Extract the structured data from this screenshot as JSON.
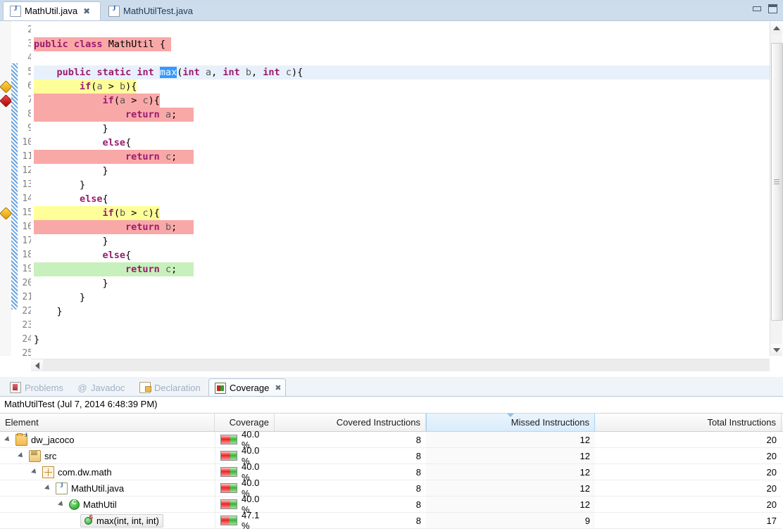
{
  "window": {
    "minimize_label": "Minimize",
    "restore_label": "Restore"
  },
  "editor": {
    "tabs": [
      {
        "label": "MathUtil.java",
        "icon": "java-file-icon",
        "active": true,
        "close": "✖"
      },
      {
        "label": "MathUtilTest.java",
        "icon": "java-file-icon",
        "active": false,
        "close": ""
      }
    ],
    "first_visible_line": 2,
    "last_visible_line": 25,
    "lines": [
      {
        "num": "2",
        "text": ""
      },
      {
        "num": "3",
        "text": "public class MathUtil {"
      },
      {
        "num": "4",
        "text": ""
      },
      {
        "num": "5",
        "text": "    public static int max(int a, int b, int c){"
      },
      {
        "num": "6",
        "text": "        if(a > b){"
      },
      {
        "num": "7",
        "text": "            if(a > c){"
      },
      {
        "num": "8",
        "text": "                return a;"
      },
      {
        "num": "9",
        "text": "            }"
      },
      {
        "num": "10",
        "text": "            else{"
      },
      {
        "num": "11",
        "text": "                return c;"
      },
      {
        "num": "12",
        "text": "            }"
      },
      {
        "num": "13",
        "text": "        }"
      },
      {
        "num": "14",
        "text": "        else{"
      },
      {
        "num": "15",
        "text": "            if(b > c){"
      },
      {
        "num": "16",
        "text": "                return b;"
      },
      {
        "num": "17",
        "text": "            }"
      },
      {
        "num": "18",
        "text": "            else{"
      },
      {
        "num": "19",
        "text": "                return c;"
      },
      {
        "num": "20",
        "text": "            }"
      },
      {
        "num": "21",
        "text": "        }"
      },
      {
        "num": "22",
        "text": "    }"
      },
      {
        "num": "23",
        "text": ""
      },
      {
        "num": "24",
        "text": "}"
      },
      {
        "num": "25",
        "text": ""
      }
    ],
    "selected_token": "max",
    "gutter_markers": [
      {
        "line": "6",
        "type": "partial-coverage-marker",
        "color": "#ffd84d"
      },
      {
        "line": "7",
        "type": "no-coverage-marker",
        "color": "#ef4a4a"
      },
      {
        "line": "15",
        "type": "partial-coverage-marker",
        "color": "#ffd84d"
      }
    ],
    "coverage_colors": {
      "covered": "#c8f0bc",
      "missed": "#f9a8a8",
      "partial": "#ffff9a",
      "current_line": "#e8f1fb",
      "selection": "#3399ff"
    }
  },
  "bottom_view": {
    "tabs": [
      {
        "label": "Problems",
        "icon": "problems-icon",
        "active": false,
        "close": ""
      },
      {
        "label": "Javadoc",
        "icon": "javadoc-icon",
        "active": false,
        "close": ""
      },
      {
        "label": "Declaration",
        "icon": "declaration-icon",
        "active": false,
        "close": ""
      },
      {
        "label": "Coverage",
        "icon": "coverage-icon",
        "active": true,
        "close": "✖"
      }
    ],
    "session": "MathUtilTest (Jul 7, 2014 6:48:39 PM)",
    "columns": [
      {
        "key": "element",
        "label": "Element"
      },
      {
        "key": "coverage",
        "label": "Coverage"
      },
      {
        "key": "covered",
        "label": "Covered Instructions"
      },
      {
        "key": "missed",
        "label": "Missed Instructions",
        "sorted": true,
        "sort_direction": "descending"
      },
      {
        "key": "total",
        "label": "Total Instructions"
      }
    ],
    "rows": [
      {
        "element": "dw_jacoco",
        "icon": "java-project-icon",
        "depth": 0,
        "expanded": true,
        "selected": false,
        "coverage": "40.0 %",
        "covered": "8",
        "missed": "12",
        "total": "20",
        "bar_percent": 40
      },
      {
        "element": "src",
        "icon": "source-folder-icon",
        "depth": 1,
        "expanded": true,
        "selected": false,
        "coverage": "40.0 %",
        "covered": "8",
        "missed": "12",
        "total": "20",
        "bar_percent": 40
      },
      {
        "element": "com.dw.math",
        "icon": "package-icon",
        "depth": 2,
        "expanded": true,
        "selected": false,
        "coverage": "40.0 %",
        "covered": "8",
        "missed": "12",
        "total": "20",
        "bar_percent": 40
      },
      {
        "element": "MathUtil.java",
        "icon": "java-file-icon",
        "depth": 3,
        "expanded": true,
        "selected": false,
        "coverage": "40.0 %",
        "covered": "8",
        "missed": "12",
        "total": "20",
        "bar_percent": 40
      },
      {
        "element": "MathUtil",
        "icon": "class-icon",
        "depth": 4,
        "expanded": true,
        "selected": false,
        "coverage": "40.0 %",
        "covered": "8",
        "missed": "12",
        "total": "20",
        "bar_percent": 40
      },
      {
        "element": "max(int, int, int)",
        "icon": "static-method-icon",
        "depth": 5,
        "expanded": false,
        "selected": true,
        "coverage": "47.1 %",
        "covered": "8",
        "missed": "9",
        "total": "17",
        "bar_percent": 47
      }
    ]
  }
}
